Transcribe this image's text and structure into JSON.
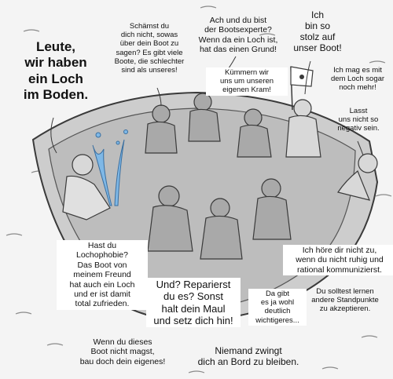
{
  "captions": {
    "hole": "Leute,\nwir haben\nein Loch\nim Boden.",
    "shame": "Schämst du\ndich nicht, sowas\nüber dein Boot zu\nsagen? Es gibt viele\nBoote, die schlechter\nsind als unseres!",
    "expert": "Ach und du bist\nder Bootsexperte?\nWenn da ein Loch ist,\nhat das einen Grund!",
    "proud": "Ich\nbin so\nstolz auf\nunser Boot!",
    "like_hole": "Ich mag es mit\ndem Loch sogar\nnoch mehr!",
    "own_stuff": "Kümmern wir\nuns um unseren\neigenen Kram!",
    "negative": "Lasst\nuns nicht so\nnegativ sein.",
    "phobia": "Hast du\nLochophobie?\nDas Boot von\nmeinem Freund\nhat auch ein Loch\nund er ist damit\ntotal zufrieden.",
    "repair": "Und? Reparierst\ndu es? Sonst\nhalt dein Maul\nund setz dich hin!",
    "important": "Da gibt\nes ja wohl\ndeutlich\nwichtigeres...",
    "rational": "Ich höre dir nicht zu,\nwenn du nicht ruhig und\nrational kommunizierst.",
    "accept": "Du solltest lernen\nandere Standpunkte\nzu akzeptieren.",
    "own_boat": "Wenn du dieses\nBoot nicht magst,\nbau doch dein eigenes!",
    "nobody": "Niemand zwingt\ndich an Bord zu bleiben."
  },
  "colors": {
    "boat": "#cdcdcd",
    "boat_inner": "#bdbdbd",
    "water": "#7fb8e6",
    "ink": "#3a3a3a"
  }
}
